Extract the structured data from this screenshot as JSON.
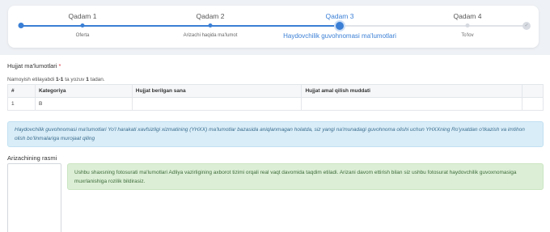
{
  "steps": [
    {
      "title": "Qadam 1",
      "label": "Oferta",
      "state": "done"
    },
    {
      "title": "Qadam 2",
      "label": "Arizachi haqida ma'lumot",
      "state": "done"
    },
    {
      "title": "Qadam 3",
      "label": "Haydovchilik guvohnomasi ma'lumotlari",
      "state": "current"
    },
    {
      "title": "Qadam 4",
      "label": "To'lov",
      "state": "pending"
    }
  ],
  "end_icon": "check-icon",
  "document_section": {
    "title": "Hujjat ma'lumotlari",
    "required_mark": "*",
    "summary_prefix": "Namoyish etilayabdi ",
    "summary_range": "1-1",
    "summary_middle": " ta yozuv ",
    "summary_total": "1",
    "summary_suffix": " tadan.",
    "columns": [
      "#",
      "Kategoriya",
      "Hujjat berilgan sana",
      "Hujjat amal qilish muddati",
      ""
    ],
    "rows": [
      [
        "1",
        "B",
        "",
        "",
        ""
      ]
    ]
  },
  "info_message": "Haydovchilik guvohnomasi ma'lumotlari Yo'l harakati xavfsizligi xizmatining (YHXX) ma'lumotlar bazasida aniqlanmagan holatda, siz yangi na'munadagi guvohnoma olishi uchun YHXXning Ro'yxatdan o'tkazish va imtihon olish bo'linmalariga murojaat qiling",
  "photo_section": {
    "label": "Arizachining rasmi",
    "notice": "Ushbu shaxsning fotosurati ma'lumotlari Adliya vazirligining axborot tizimi orqali real vaqt davomida taqdim etiladi. Arizani davom ettirish bilan siz ushbu fotosurat haydovchilik guvoxnomasiga muxrlanishiga rozilik bildirasiz."
  },
  "colors": {
    "accent": "#3a7fd5",
    "info_bg": "#d9edf8",
    "success_bg": "#dcefd6",
    "required": "#d9363e"
  }
}
